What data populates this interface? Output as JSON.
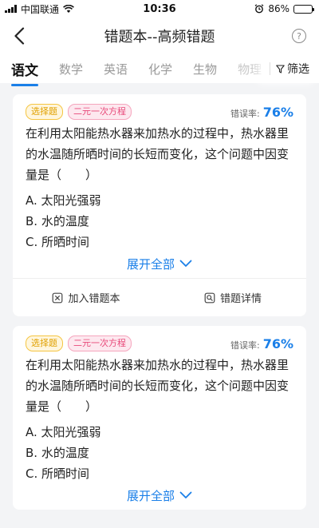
{
  "status_bar": {
    "carrier": "中国联通",
    "time": "10:36",
    "battery_percent": "86%",
    "battery_level": 0.86
  },
  "nav": {
    "title": "错题本--高频错题"
  },
  "tabs": [
    {
      "label": "语文",
      "active": true
    },
    {
      "label": "数学",
      "active": false
    },
    {
      "label": "英语",
      "active": false
    },
    {
      "label": "化学",
      "active": false
    },
    {
      "label": "生物",
      "active": false
    },
    {
      "label": "物理",
      "active": false
    }
  ],
  "filter_label": "筛选",
  "cards": [
    {
      "type_tag": "选择题",
      "topic_tag": "二元一次方程",
      "error_rate_label": "错误率:",
      "error_rate": "76%",
      "question": "在利用太阳能热水器来加热水的过程中，热水器里的水温随所晒时间的长短而变化，这个问题中因变量是（　　）",
      "options": [
        "A. 太阳光强弱",
        "B. 水的温度",
        "C. 所晒时间"
      ],
      "expand_label": "展开全部",
      "add_label": "加入错题本",
      "detail_label": "错题详情"
    },
    {
      "type_tag": "选择题",
      "topic_tag": "二元一次方程",
      "error_rate_label": "错误率:",
      "error_rate": "76%",
      "question": "在利用太阳能热水器来加热水的过程中，热水器里的水温随所晒时间的长短而变化，这个问题中因变量是（　　）",
      "options": [
        "A. 太阳光强弱",
        "B. 水的温度",
        "C. 所晒时间"
      ],
      "expand_label": "展开全部"
    }
  ],
  "colors": {
    "accent": "#1a7fe8",
    "type_tag": "#e0a000",
    "topic_tag": "#e84a7a"
  }
}
